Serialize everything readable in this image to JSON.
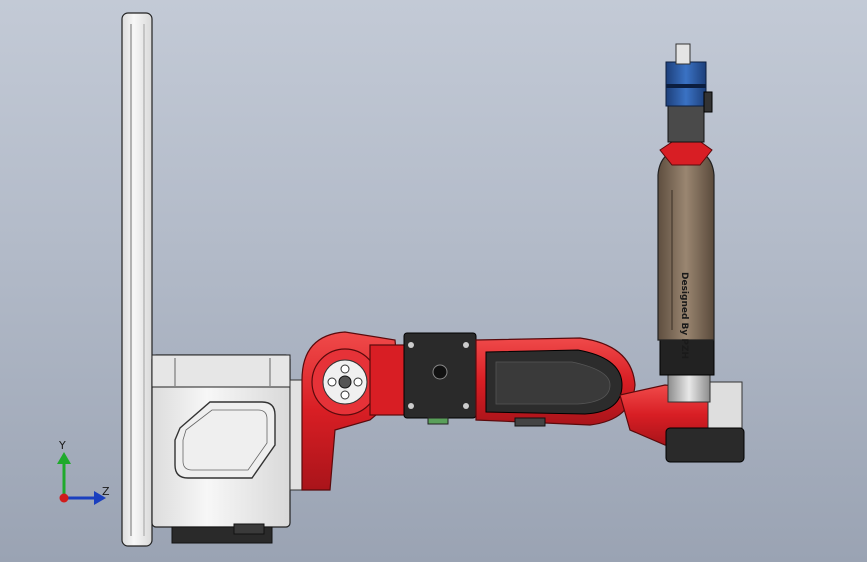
{
  "engraving": "Designed By PZH",
  "triad": {
    "y_label": "Y",
    "z_label": "Z"
  },
  "colors": {
    "background_top": "#c3cad6",
    "background_bottom": "#9aa3b3",
    "arm_red": "#d81e24",
    "link_dark": "#2a2a2a",
    "link_bronze": "#7e6a55",
    "panel_white": "#f4f4f4",
    "motor_blue": "#2b5ea8",
    "axis_y": "#1faa2c",
    "axis_z": "#1a3fbf",
    "axis_x": "#d01c1c"
  },
  "icons": [
    "coordinate-triad-icon"
  ]
}
